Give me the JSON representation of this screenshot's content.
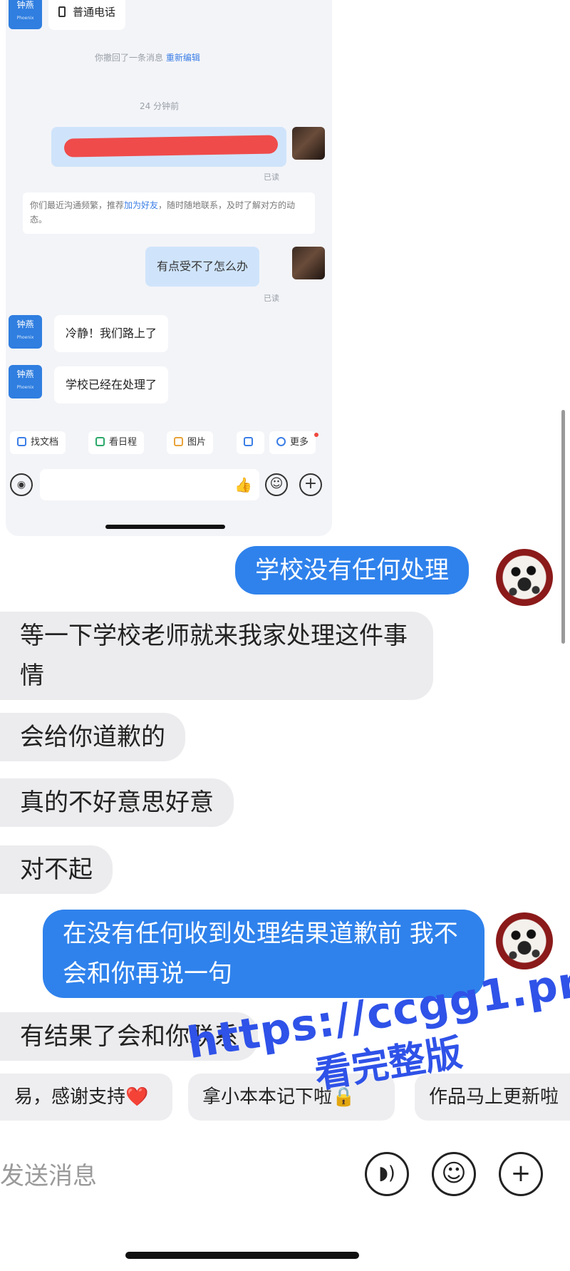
{
  "inner_chat": {
    "sender_avatar_label": "钟燕",
    "call_label": "普通电话",
    "recalled_notice": "你撤回了一条消息",
    "re_edit_link": "重新编辑",
    "time_divider": "24 分钟前",
    "read_status": "已读",
    "suggestion_text_prefix": "你们最近沟通频繁，推荐",
    "suggestion_link": "加为好友",
    "suggestion_text_suffix": "，随时随地联系，及时了解对方的动态。",
    "my_message": "有点受不了怎么办",
    "reply_1": "冷静！我们路上了",
    "reply_2": "学校已经在处理了",
    "quick_actions": [
      "找文档",
      "看日程",
      "图片",
      "",
      "更多"
    ]
  },
  "chat": {
    "messages": [
      {
        "side": "right",
        "text": "学校没有任何处理"
      },
      {
        "side": "left",
        "text": "等一下学校老师就来我家处理这件事情"
      },
      {
        "side": "left",
        "text": "会给你道歉的"
      },
      {
        "side": "left",
        "text": "真的不好意思好意"
      },
      {
        "side": "left",
        "text": "对不起"
      },
      {
        "side": "right",
        "text": "在没有任何收到处理结果道歉前 我不会和你再说一句"
      },
      {
        "side": "left",
        "text": "有结果了会和你联系"
      }
    ]
  },
  "quick_replies": [
    "易，感谢支持❤️",
    "拿小本本记下啦🔒",
    "作品马上更新啦"
  ],
  "composer": {
    "placeholder": "发送消息"
  },
  "watermark": {
    "line1": "https://ccgg1.pro",
    "line2": "看完整版"
  },
  "colors": {
    "accent_blue": "#2f82ec",
    "received_bubble": "#ececee",
    "watermark": "#2f52e8"
  }
}
